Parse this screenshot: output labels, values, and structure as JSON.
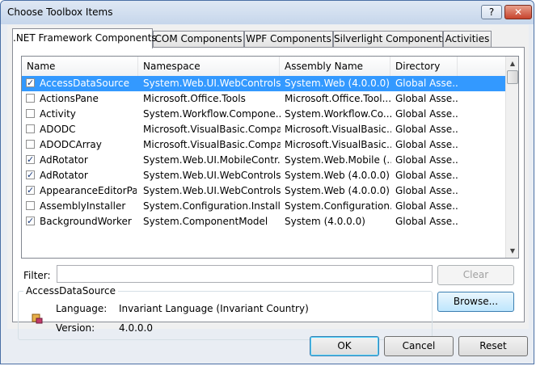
{
  "window": {
    "title": "Choose Toolbox Items",
    "help_label": "?",
    "close_label": "✕"
  },
  "tabs": [
    {
      "label": ".NET Framework Components",
      "active": true
    },
    {
      "label": "COM Components",
      "active": false
    },
    {
      "label": "WPF Components",
      "active": false
    },
    {
      "label": "Silverlight Components",
      "active": false
    },
    {
      "label": "Activities",
      "active": false
    }
  ],
  "list": {
    "columns": [
      "Name",
      "Namespace",
      "Assembly Name",
      "Directory"
    ],
    "rows": [
      {
        "checked": true,
        "selected": true,
        "name": "AccessDataSource",
        "namespace": "System.Web.UI.WebControls",
        "assembly": "System.Web (4.0.0.0)",
        "directory": "Global Asse..."
      },
      {
        "checked": false,
        "selected": false,
        "name": "ActionsPane",
        "namespace": "Microsoft.Office.Tools",
        "assembly": "Microsoft.Office.Tool...",
        "directory": "Global Asse..."
      },
      {
        "checked": false,
        "selected": false,
        "name": "Activity",
        "namespace": "System.Workflow.Compone...",
        "assembly": "System.Workflow.Co...",
        "directory": "Global Asse..."
      },
      {
        "checked": false,
        "selected": false,
        "name": "ADODC",
        "namespace": "Microsoft.VisualBasic.Compa...",
        "assembly": "Microsoft.VisualBasic....",
        "directory": "Global Asse..."
      },
      {
        "checked": false,
        "selected": false,
        "name": "ADODCArray",
        "namespace": "Microsoft.VisualBasic.Compa...",
        "assembly": "Microsoft.VisualBasic....",
        "directory": "Global Asse..."
      },
      {
        "checked": true,
        "selected": false,
        "name": "AdRotator",
        "namespace": "System.Web.UI.MobileContr...",
        "assembly": "System.Web.Mobile (...",
        "directory": "Global Asse..."
      },
      {
        "checked": true,
        "selected": false,
        "name": "AdRotator",
        "namespace": "System.Web.UI.WebControls",
        "assembly": "System.Web (4.0.0.0)",
        "directory": "Global Asse..."
      },
      {
        "checked": true,
        "selected": false,
        "name": "AppearanceEditorPart",
        "namespace": "System.Web.UI.WebControls....",
        "assembly": "System.Web (4.0.0.0)",
        "directory": "Global Asse..."
      },
      {
        "checked": false,
        "selected": false,
        "name": "AssemblyInstaller",
        "namespace": "System.Configuration.Install",
        "assembly": "System.Configuration...",
        "directory": "Global Asse..."
      },
      {
        "checked": true,
        "selected": false,
        "name": "BackgroundWorker",
        "namespace": "System.ComponentModel",
        "assembly": "System (4.0.0.0)",
        "directory": "Global Asse..."
      }
    ]
  },
  "filter": {
    "label": "Filter:",
    "value": ""
  },
  "buttons": {
    "clear": "Clear",
    "browse": "Browse...",
    "ok": "OK",
    "cancel": "Cancel",
    "reset": "Reset"
  },
  "details": {
    "title": "AccessDataSource",
    "language_label": "Language:",
    "language_value": "Invariant Language (Invariant Country)",
    "version_label": "Version:",
    "version_value": "4.0.0.0"
  },
  "colors": {
    "selection": "#3399ff",
    "titlebar": "#c6d6eb",
    "close": "#c7432d"
  }
}
